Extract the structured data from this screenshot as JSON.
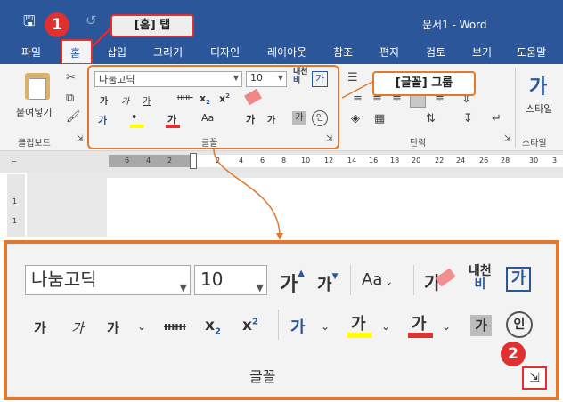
{
  "titlebar": {
    "doc_title": "문서1 - Word"
  },
  "tabs": [
    "파일",
    "홈",
    "삽입",
    "그리기",
    "디자인",
    "레이아웃",
    "참조",
    "편지",
    "검토",
    "보기",
    "도움말"
  ],
  "ribbon": {
    "clipboard": {
      "paste_label": "붙여넣기",
      "group_label": "클립보드"
    },
    "font": {
      "font_name": "나눔고딕",
      "font_size": "10",
      "group_label": "글꼴"
    },
    "paragraph": {
      "group_label": "단락"
    },
    "styles": {
      "styles_label": "스타일",
      "group_label": "스타일"
    }
  },
  "ruler": {
    "ticks": [
      "6",
      "4",
      "2",
      "2",
      "4",
      "6",
      "8",
      "10",
      "12",
      "14",
      "16",
      "18",
      "20",
      "22",
      "24",
      "26",
      "28",
      "30",
      "3"
    ]
  },
  "vruler": {
    "ticks": [
      "1",
      "1"
    ]
  },
  "callouts": {
    "home_tab": "[홈] 탭",
    "font_group": "[글꼴] 그룹",
    "step1": "1",
    "step2": "2"
  },
  "zoom": {
    "font_name": "나눔고딕",
    "font_size": "10",
    "group_label": "글꼴",
    "hanja_top": "내천",
    "hanja_bottom": "비"
  },
  "glyphs": {
    "ga": "가",
    "aa": "Aa",
    "enclosed": "인",
    "strike": "ʜʜʜ",
    "x": "x"
  },
  "colors": {
    "accent": "#2b579a",
    "callout": "#e07830",
    "badge": "#e03030",
    "highlight": "#ffff00",
    "fontcolor": "#e03030"
  }
}
